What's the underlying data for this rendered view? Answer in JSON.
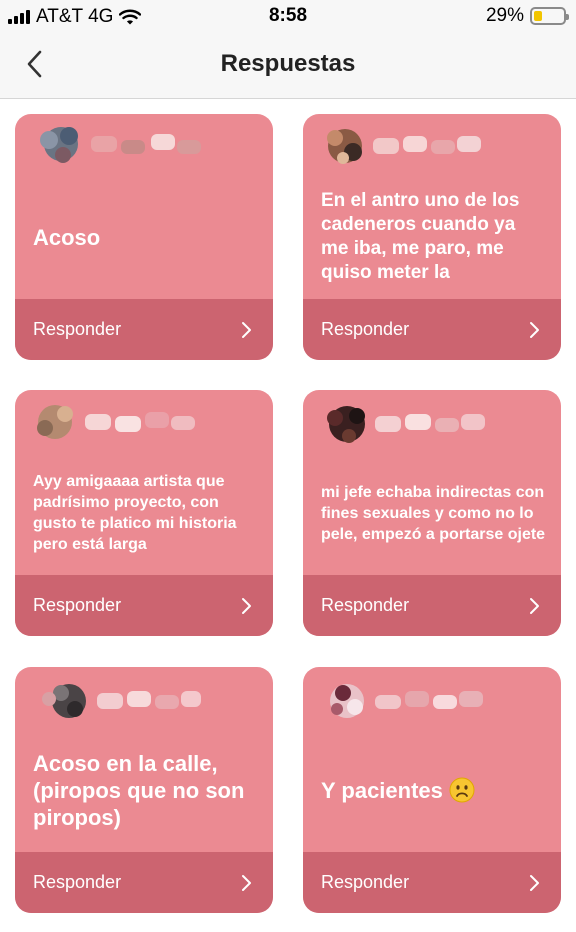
{
  "status_bar": {
    "carrier": "AT&T 4G",
    "time": "8:58",
    "battery_percent": "29%",
    "battery_level": 0.29
  },
  "nav": {
    "title": "Respuestas",
    "back_icon": "chevron-left-icon"
  },
  "cards": [
    {
      "text": "Acoso",
      "reply_label": "Responder"
    },
    {
      "text": "En el antro uno de los cadeneros cuando ya me iba, me paro, me quiso meter la",
      "reply_label": "Responder"
    },
    {
      "text": "Ayy amigaaaa artista que padrísimo proyecto, con gusto te platico mi historia pero está larga",
      "reply_label": "Responder"
    },
    {
      "text": "mi jefe  echaba indirectas con fines sexuales y como no lo pele, empezó a portarse ojete",
      "reply_label": "Responder"
    },
    {
      "text": "Acoso en la calle, (piropos que no son piropos)",
      "reply_label": "Responder"
    },
    {
      "text": "Y pacientes",
      "emoji": "frowning-face-emoji",
      "reply_label": "Responder"
    }
  ],
  "colors": {
    "card": "#eb8a92",
    "card_footer": "#cc6470",
    "nav_background": "#f7f7f7",
    "battery": "#f2c500"
  }
}
